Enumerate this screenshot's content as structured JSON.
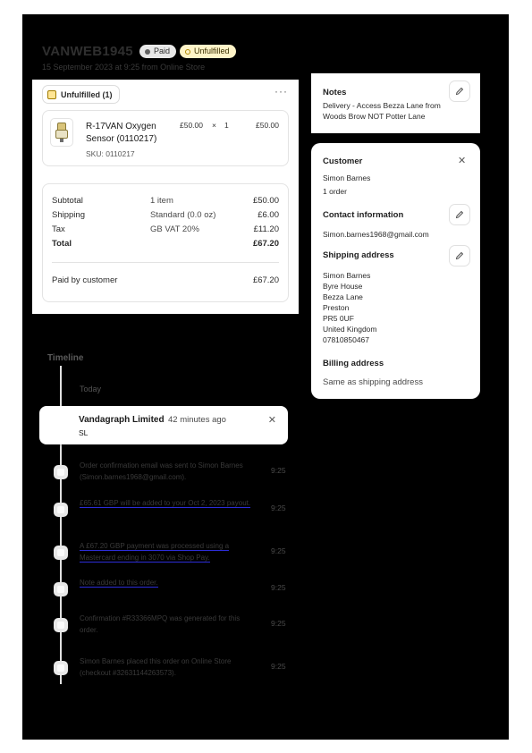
{
  "order": {
    "id": "VANWEB1945",
    "badge_paid": "Paid",
    "badge_unfulfilled": "Unfulfilled",
    "meta": "15 September 2023 at 9:25 from Online Store"
  },
  "fulfillment": {
    "label": "Unfulfilled (1)",
    "more": "···",
    "item": {
      "name": "R-17VAN Oxygen Sensor (0110217)",
      "sku": "SKU: 0110217",
      "price": "£50.00",
      "times": "×",
      "qty": "1",
      "total": "£50.00"
    }
  },
  "summary": {
    "rows": [
      {
        "label": "Subtotal",
        "detail": "1 item",
        "value": "£50.00"
      },
      {
        "label": "Shipping",
        "detail": "Standard (0.0 oz)",
        "value": "£6.00"
      },
      {
        "label": "Tax",
        "detail": "GB VAT 20%",
        "value": "£11.20"
      },
      {
        "label": "Total",
        "detail": "",
        "value": "£67.20"
      }
    ],
    "paid_label": "Paid by customer",
    "paid_value": "£67.20"
  },
  "notes": {
    "title": "Notes",
    "text": "Delivery - Access Bezza Lane from Woods Brow NOT Potter Lane"
  },
  "customer": {
    "title": "Customer",
    "name": "Simon Barnes",
    "orders": "1 order",
    "contact_title": "Contact information",
    "email": "Simon.barnes1968@gmail.com",
    "shipping_title": "Shipping address",
    "address": [
      "Simon Barnes",
      "Byre House",
      "Bezza Lane",
      "Preston",
      "PR5 0UF",
      "United Kingdom",
      "07810850467"
    ],
    "billing_title": "Billing address",
    "billing_text": "Same as shipping address"
  },
  "timeline": {
    "title": "Timeline",
    "today": "Today",
    "comment": {
      "name": "Vandagraph Limited",
      "time": "42 minutes ago",
      "initials": "SL"
    },
    "events": [
      {
        "text": "Order confirmation email was sent to Simon Barnes (Simon.barnes1968@gmail.com).",
        "time": "9:25"
      },
      {
        "text": "£65.61 GBP will be added to your Oct 2, 2023 payout.",
        "time": "9:25"
      },
      {
        "text": "A £67.20 GBP payment was processed using a Mastercard ending in 3070 via Shop Pay.",
        "time": "9:25"
      },
      {
        "text": "Note added to this order.",
        "time": "9:25"
      },
      {
        "text": "Confirmation #R33366MPQ was generated for this order.",
        "time": "9:25"
      },
      {
        "text": "Simon Barnes placed this order on Online Store (checkout #32631144263573).",
        "time": "9:25"
      }
    ]
  },
  "colors": {
    "background_frame": "#000000",
    "unfulfilled_badge": "#fff4c8",
    "paid_badge": "#e8e8e8",
    "link_underline": "#2c2cd8"
  },
  "icons": [
    "pencil-icon",
    "close-icon",
    "more-icon",
    "fulfillment-box-icon"
  ]
}
